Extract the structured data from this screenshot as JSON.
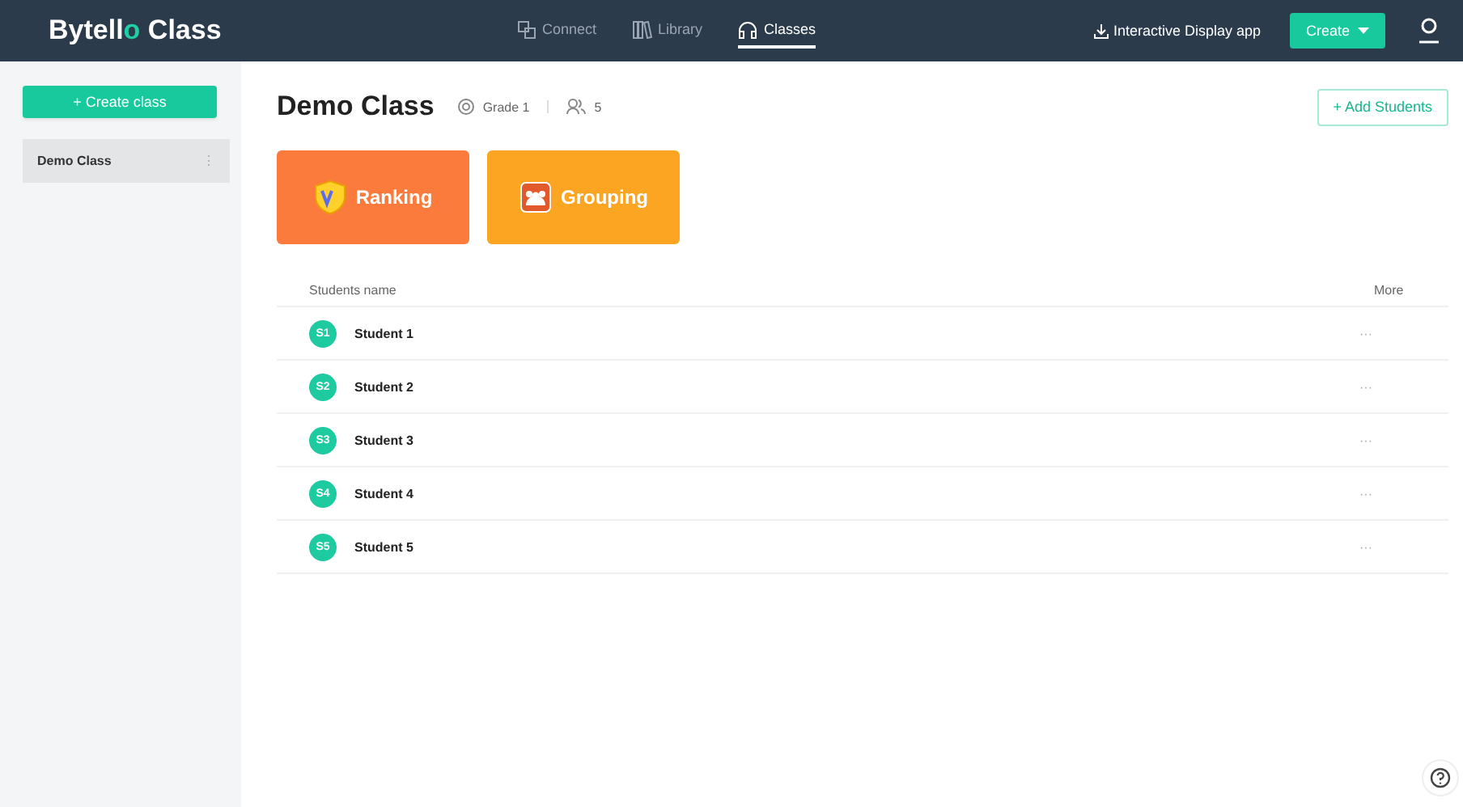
{
  "header": {
    "logo": {
      "text": "Bytell",
      "accent": "o",
      "suffix": "Class"
    },
    "nav": [
      {
        "label": "Connect",
        "kind": "connect",
        "selected": false
      },
      {
        "label": "Library",
        "kind": "library",
        "selected": false
      },
      {
        "label": "Classes",
        "kind": "classes",
        "selected": true
      }
    ],
    "download_link": "Interactive Display app",
    "create_button": "Create"
  },
  "sidebar": {
    "create_button": "+ Create class",
    "items": [
      {
        "label": "Demo Class",
        "menu": "⋮",
        "selected": true
      }
    ]
  },
  "class": {
    "title": "Demo Class",
    "grade": "Grade 1",
    "student_count": "5",
    "add_button": "+ Add Students"
  },
  "tools": [
    {
      "label": "Ranking",
      "kind": "ranking"
    },
    {
      "label": "Grouping",
      "kind": "grouping"
    }
  ],
  "table": {
    "columns": [
      "Students name",
      "More"
    ],
    "rows": [
      {
        "avatar": "S1",
        "name": "Student 1",
        "more": "···"
      },
      {
        "avatar": "S2",
        "name": "Student 2",
        "more": "···"
      },
      {
        "avatar": "S3",
        "name": "Student 3",
        "more": "···"
      },
      {
        "avatar": "S4",
        "name": "Student 4",
        "more": "···"
      },
      {
        "avatar": "S5",
        "name": "Student 5",
        "more": "···"
      }
    ]
  }
}
